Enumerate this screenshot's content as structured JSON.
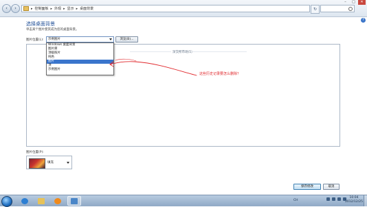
{
  "address": {
    "breadcrumb": [
      "控制面板",
      "外观",
      "显示",
      "桌面背景"
    ],
    "separator": "▸"
  },
  "window": {
    "minimize": "–",
    "maximize": "□",
    "close": "✕",
    "help": "?"
  },
  "content": {
    "title": "选择桌面背景",
    "description": "单击某个图片使其成为您的桌面背景。",
    "location_label": "图片位置(L):",
    "location_value": "示例图片",
    "browse_label": "浏览(B)...",
    "dropdown_options": [
      "Windows 桌面背景",
      "图片库",
      "顶级照片",
      "纯色",
      "图片",
      "顶",
      "示例图片"
    ],
    "selected_option_index": 4,
    "group_header": "深交所市场(5)",
    "annotation": "这些历史记录要怎么删除？",
    "position_label": "图片位置(P):",
    "position_value": "填充",
    "save_label": "保存修改",
    "cancel_label": "取消"
  },
  "taskbar": {
    "lang": "CH",
    "time": "10:04",
    "date": "2012/12/25"
  },
  "colors": {
    "annotation": "#e0262a",
    "title": "#1c4c96",
    "selection": "#3a75cc"
  }
}
